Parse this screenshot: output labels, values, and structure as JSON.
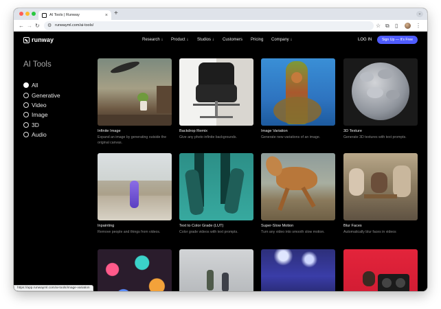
{
  "browser": {
    "tab_title": "AI Tools | Runway",
    "tab_close": "×",
    "new_tab": "+",
    "tab_dropdown": "⌄",
    "url": "runwayml.com/ai-tools/",
    "status_url": "https://app.runwayml.com/ai-tools/image-variation",
    "icons": {
      "back": "←",
      "forward": "→",
      "reload": "↻",
      "tune": "⚙",
      "star": "☆",
      "extensions": "⧉",
      "side_panel": "▯",
      "menu": "⋮"
    }
  },
  "nav": {
    "logo_text": "runway",
    "links": [
      "Research ↓",
      "Product ↓",
      "Studios ↓",
      "Customers",
      "Pricing",
      "Company ↓"
    ],
    "login": "LOG IN",
    "signup": "Sign Up — It's Free"
  },
  "page": {
    "title": "AI Tools",
    "filters": [
      "All",
      "Generative",
      "Video",
      "Image",
      "3D",
      "Audio"
    ],
    "selected_filter": "All"
  },
  "cards": [
    {
      "title": "Infinite Image",
      "desc": "Expand an image by generating outside the original canvas.",
      "visual": "surreal-landscape-with-bird-and-plant"
    },
    {
      "title": "Backdrop Remix",
      "desc": "Give any photo infinite backgrounds.",
      "visual": "lounge-chair-split-background"
    },
    {
      "title": "Image Variation",
      "desc": "Generate new variations of an image.",
      "visual": "mossy-rock-tower-on-blue"
    },
    {
      "title": "3D Texture",
      "desc": "Generate 3D textures with text prompts.",
      "visual": "gray-stone-sphere"
    },
    {
      "title": "Inpainting",
      "desc": "Remove people and things from videos.",
      "visual": "purple-object-on-beach"
    },
    {
      "title": "Text to Color Grade (LUT)",
      "desc": "Color grade videos with text prompts.",
      "visual": "skateboarder-teal-grade"
    },
    {
      "title": "Super-Slow Motion",
      "desc": "Turn any video into smooth slow motion.",
      "visual": "galloping-horse"
    },
    {
      "title": "Blur Faces",
      "desc": "Automatically blur faces in videos",
      "visual": "outdoor-cafe-people"
    },
    {
      "title": "",
      "desc": "",
      "visual": "colorful-bokeh-lights"
    },
    {
      "title": "",
      "desc": "",
      "visual": "people-walking-street"
    },
    {
      "title": "",
      "desc": "",
      "visual": "concert-crowd-stage-lights"
    },
    {
      "title": "",
      "desc": "",
      "visual": "person-with-boombox-on-red"
    }
  ],
  "colors": {
    "page_bg": "#000000",
    "signup_bg": "#4f5cff",
    "tab_strip_bg": "#dfe3ea"
  }
}
